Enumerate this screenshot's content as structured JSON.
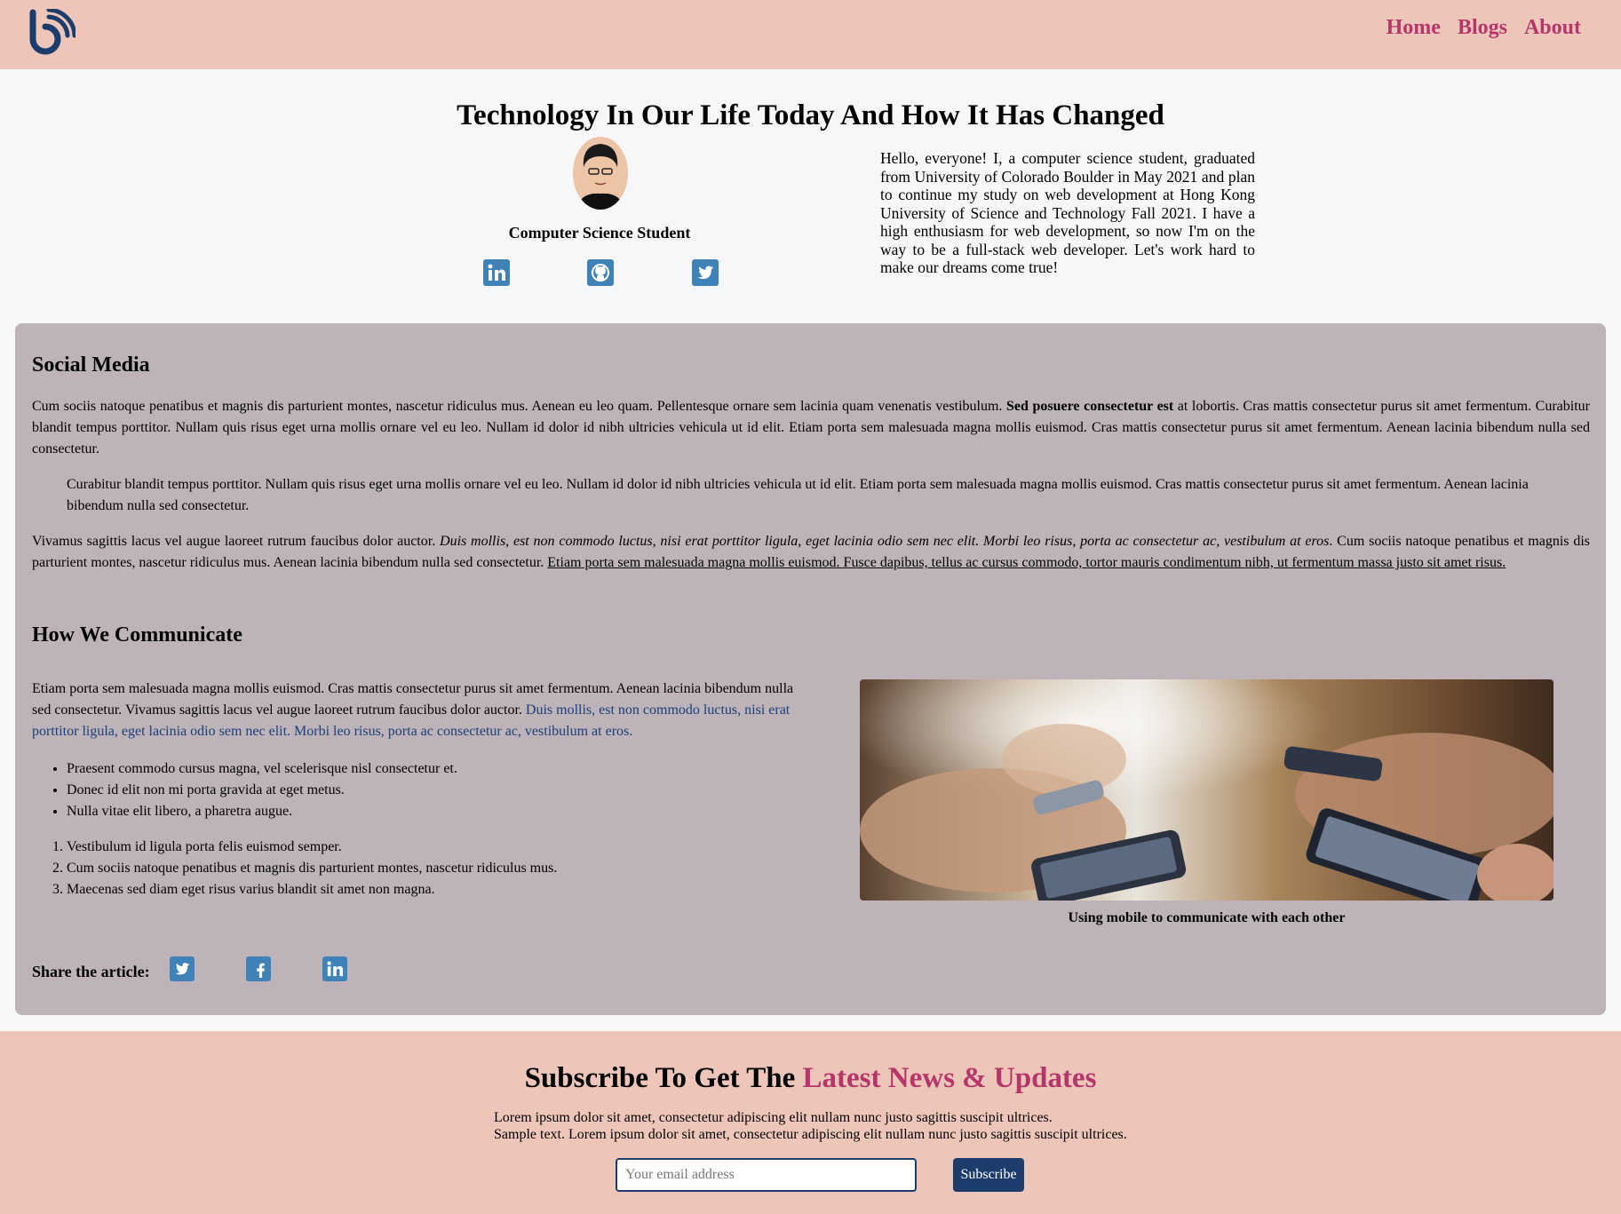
{
  "nav": {
    "logo_name": "blog-logo",
    "items": [
      {
        "label": "Home"
      },
      {
        "label": "Blogs"
      },
      {
        "label": "About"
      }
    ],
    "link_color": "#b5366a"
  },
  "hero": {
    "title": "Technology In Our Life Today And How It Has Changed",
    "role": "Computer Science Student",
    "social_icons": [
      "linkedin-icon",
      "github-icon",
      "twitter-icon"
    ],
    "bio": "Hello, everyone! I, a computer science student, graduated from University of Colorado Boulder in May 2021 and plan to continue my study on web development at Hong Kong University of Science and Technology Fall 2021. I have a high enthusiasm for web development, so now I'm on the way to be a full-stack web developer. Let's work hard to make our dreams come true!"
  },
  "article": {
    "background": "#bdb3b8",
    "section1": {
      "heading": "Social Media",
      "p1_start": "Cum sociis natoque penatibus et magnis dis parturient montes, nascetur ridiculus mus. Aenean eu leo quam. Pellentesque ornare sem lacinia quam venenatis vestibulum. ",
      "p1_bold": "Sed posuere consectetur est",
      "p1_end": " at lobortis. Cras mattis consectetur purus sit amet fermentum. Curabitur blandit tempus porttitor. Nullam quis risus eget urna mollis ornare vel eu leo. Nullam id dolor id nibh ultricies vehicula ut id elit. Etiam porta sem malesuada magna mollis euismod. Cras mattis consectetur purus sit amet fermentum. Aenean lacinia bibendum nulla sed consectetur.",
      "blockquote": "Curabitur blandit tempus porttitor. Nullam quis risus eget urna mollis ornare vel eu leo. Nullam id dolor id nibh ultricies vehicula ut id elit. Etiam porta sem malesuada magna mollis euismod. Cras mattis consectetur purus sit amet fermentum. Aenean lacinia bibendum nulla sed consectetur.",
      "p2_start": "Vivamus sagittis lacus vel augue laoreet rutrum faucibus dolor auctor. ",
      "p2_italic": "Duis mollis, est non commodo luctus, nisi erat porttitor ligula, eget lacinia odio sem nec elit. Morbi leo risus, porta ac consectetur ac, vestibulum at eros",
      "p2_mid": ". Cum sociis natoque penatibus et magnis dis parturient montes, nascetur ridiculus mus. Aenean lacinia bibendum nulla sed consectetur. ",
      "p2_underline": "Etiam porta sem malesuada magna mollis euismod. Fusce dapibus, tellus ac cursus commodo, tortor mauris condimentum nibh, ut fermentum massa justo sit amet risus."
    },
    "section2": {
      "heading": "How We Communicate",
      "intro_start": "Etiam porta sem malesuada magna mollis euismod. Cras mattis consectetur purus sit amet fermentum. Aenean lacinia bibendum nulla sed consectetur. Vivamus sagittis lacus vel augue laoreet rutrum faucibus dolor auctor. ",
      "intro_link": "Duis mollis, est non commodo luctus, nisi erat porttitor ligula, eget lacinia odio sem nec elit. Morbi leo risus, porta ac consectetur ac, vestibulum at eros.",
      "bullets": [
        "Praesent commodo cursus magna, vel scelerisque nisl consectetur et.",
        "Donec id elit non mi porta gravida at eget metus.",
        "Nulla vitae elit libero, a pharetra augue."
      ],
      "numbered": [
        "Vestibulum id ligula porta felis euismod semper.",
        "Cum sociis natoque penatibus et magnis dis parturient montes, nascetur ridiculus mus.",
        "Maecenas sed diam eget risus varius blandit sit amet non magna."
      ],
      "caption": "Using mobile to communicate with each other"
    },
    "share": {
      "label": "Share the article:",
      "icons": [
        "twitter-icon",
        "facebook-icon",
        "linkedin-icon"
      ]
    }
  },
  "subscribe": {
    "title_plain": "Subscribe To Get The ",
    "title_accent": "Latest News & Updates",
    "line1": "Lorem ipsum dolor sit amet, consectetur adipiscing elit nullam nunc justo sagittis suscipit ultrices.",
    "line2": "Sample text. Lorem ipsum dolor sit amet, consectetur adipiscing elit nullam nunc justo sagittis suscipit ultrices.",
    "email_placeholder": "Your email address",
    "button_label": "Subscribe",
    "button_color": "#1c3c6b"
  }
}
